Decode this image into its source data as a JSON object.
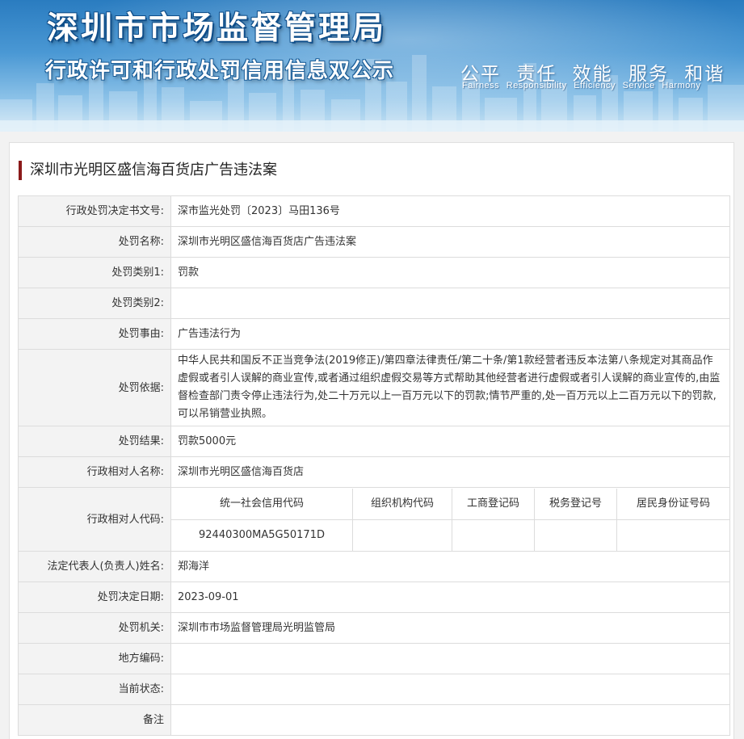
{
  "banner": {
    "title": "深圳市市场监督管理局",
    "subtitle": "行政许可和行政处罚信用信息双公示",
    "slogan_cn": [
      "公平",
      "责任",
      "效能",
      "服务",
      "和谐"
    ],
    "slogan_en": [
      "Fairness",
      "Responsibility",
      "Efficiency",
      "Service",
      "Harmony"
    ]
  },
  "case_title": "深圳市光明区盛信海百货店广告违法案",
  "rows": {
    "doc_no": {
      "label": "行政处罚决定书文号:",
      "value": "深市监光处罚〔2023〕马田136号"
    },
    "name": {
      "label": "处罚名称:",
      "value": "深圳市光明区盛信海百货店广告违法案"
    },
    "category1": {
      "label": "处罚类别1:",
      "value": "罚款"
    },
    "category2": {
      "label": "处罚类别2:",
      "value": ""
    },
    "reason": {
      "label": "处罚事由:",
      "value": "广告违法行为"
    },
    "basis": {
      "label": "处罚依据:",
      "value": "中华人民共和国反不正当竞争法(2019修正)/第四章法律责任/第二十条/第1款经营者违反本法第八条规定对其商品作虚假或者引人误解的商业宣传,或者通过组织虚假交易等方式帮助其他经营者进行虚假或者引人误解的商业宣传的,由监督检查部门责令停止违法行为,处二十万元以上一百万元以下的罚款;情节严重的,处一百万元以上二百万元以下的罚款,可以吊销营业执照。"
    },
    "result": {
      "label": "处罚结果:",
      "value": "罚款5000元"
    },
    "party_name": {
      "label": "行政相对人名称:",
      "value": "深圳市光明区盛信海百货店"
    },
    "party_code": {
      "label": "行政相对人代码:",
      "headers": [
        "统一社会信用代码",
        "组织机构代码",
        "工商登记码",
        "税务登记号",
        "居民身份证号码"
      ],
      "values": [
        "92440300MA5G50171D",
        "",
        "",
        "",
        ""
      ]
    },
    "legal_rep": {
      "label": "法定代表人(负责人)姓名:",
      "value": "郑海洋"
    },
    "decision_date": {
      "label": "处罚决定日期:",
      "value": "2023-09-01"
    },
    "authority": {
      "label": "处罚机关:",
      "value": "深圳市市场监督管理局光明监管局"
    },
    "local_code": {
      "label": "地方编码:",
      "value": ""
    },
    "status": {
      "label": "当前状态:",
      "value": ""
    },
    "remarks": {
      "label": "备注",
      "value": ""
    }
  },
  "colors": {
    "accent_bar": "#8b1a1a",
    "banner_blue": "#2a7cc0",
    "label_bg": "#f3f3f3",
    "border": "#dcdcdc"
  }
}
